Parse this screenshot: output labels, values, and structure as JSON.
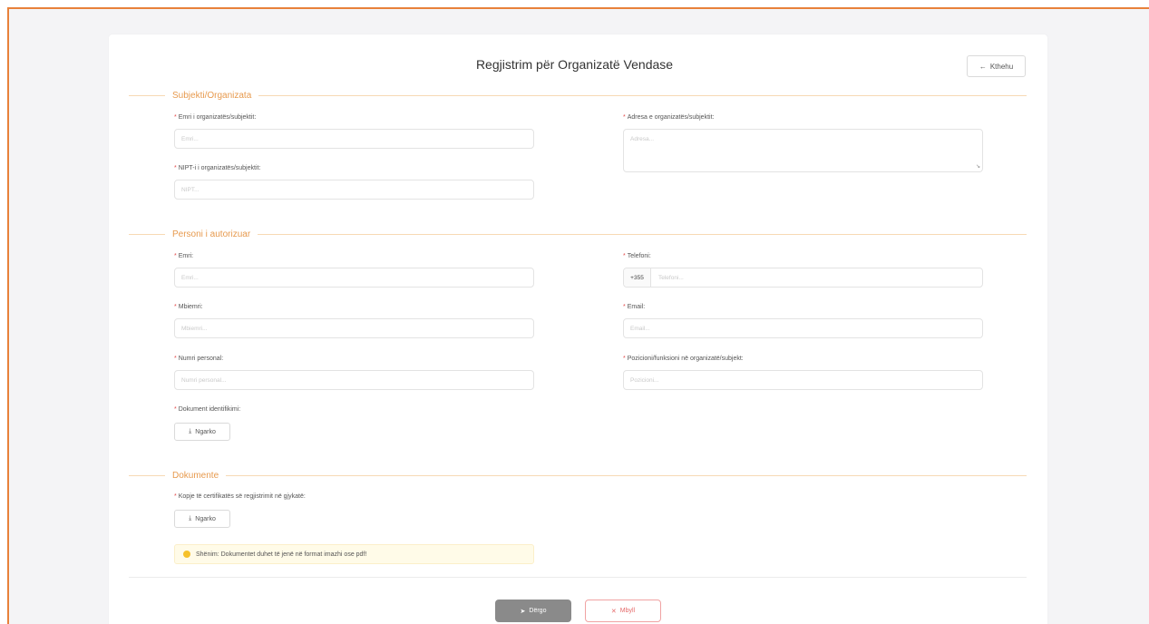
{
  "page": {
    "title": "Regjistrim për Organizatë Vendase",
    "back_label": "Kthehu"
  },
  "sections": {
    "subject": "Subjekti/Organizata",
    "person": "Personi i autorizuar",
    "documents": "Dokumente"
  },
  "required_mark": "*",
  "subject": {
    "name_label": "Emri i organizatës/subjektit:",
    "name_placeholder": "Emri...",
    "nipt_label": "NIPT-i i organizatës/subjektit:",
    "nipt_placeholder": "NIPT...",
    "address_label": "Adresa e organizatës/subjektit:",
    "address_placeholder": "Adresa..."
  },
  "person": {
    "first_name_label": "Emri:",
    "first_name_placeholder": "Emri...",
    "last_name_label": "Mbiemri:",
    "last_name_placeholder": "Mbiemri...",
    "personal_number_label": "Numri personal:",
    "personal_number_placeholder": "Numri personal...",
    "id_doc_label": "Dokument identifikimi:",
    "phone_label": "Telefoni:",
    "phone_prefix": "+355",
    "phone_placeholder": "Telefoni...",
    "email_label": "Email:",
    "email_placeholder": "Email...",
    "position_label": "Pozicioni/funksioni në organizatë/subjekt:",
    "position_placeholder": "Pozicioni..."
  },
  "documents": {
    "certificate_label": "Kopje të certifikatës së regjistrimit në gjykatë:",
    "note": "Shënim: Dokumentet duhet të jenë në format imazhi ose pdf!"
  },
  "upload_label": "Ngarko",
  "actions": {
    "send": "Dërgo",
    "close": "Mbyll"
  },
  "colors": {
    "accent": "#e8813a",
    "section_title": "#e79a4e",
    "required": "#e24b4b",
    "send_button": "#8a8a8a",
    "close_button": "#e56a6a",
    "note_dot": "#f6c12a"
  },
  "icons": {
    "back": "arrow-left-icon",
    "upload": "upload-icon",
    "send": "send-icon",
    "close": "close-icon",
    "note": "info-dot-icon"
  }
}
